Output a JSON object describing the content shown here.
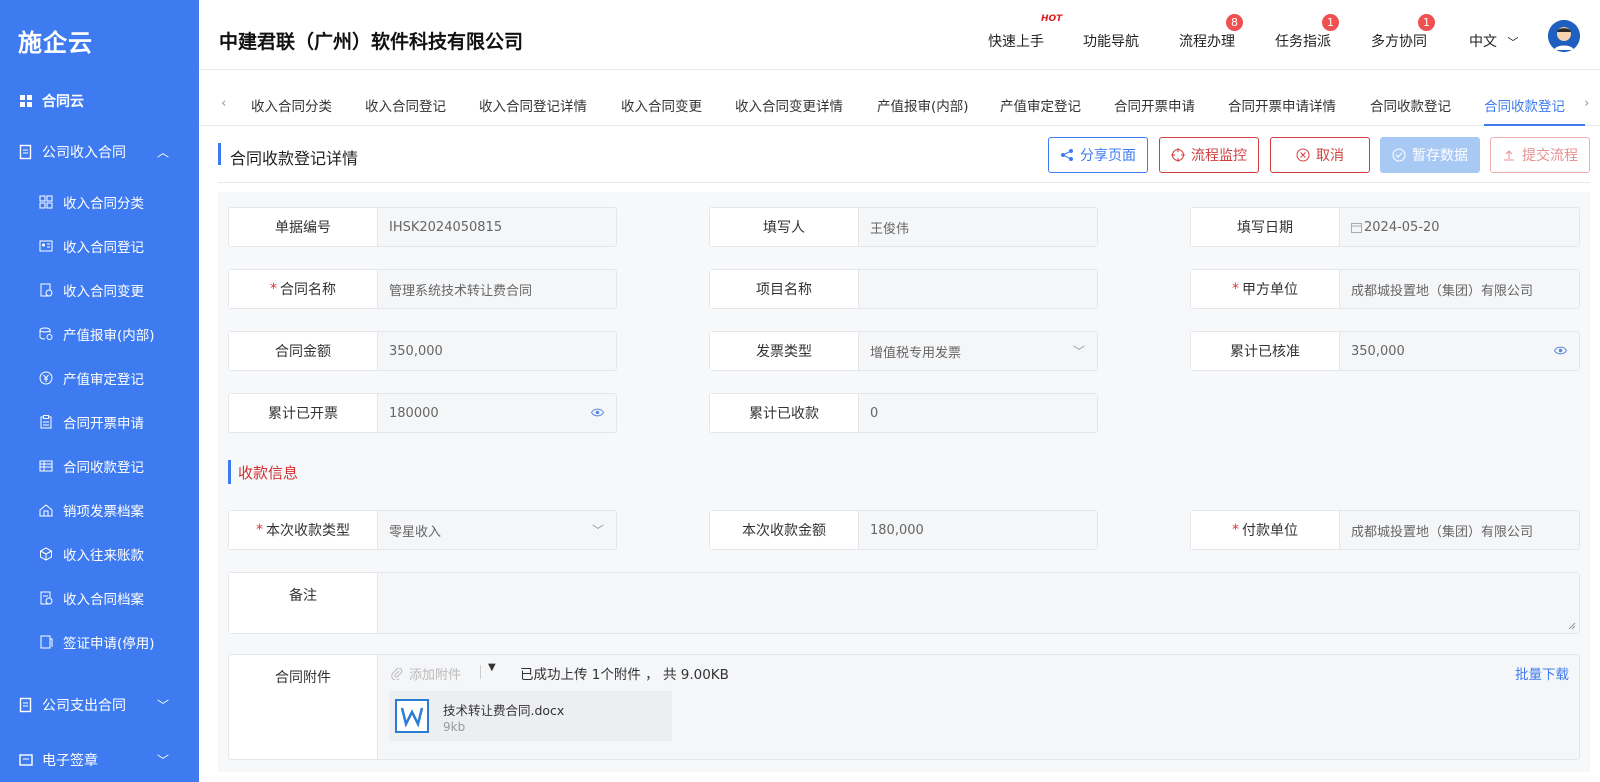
{
  "logo": {
    "text": "施企云"
  },
  "sidebar": {
    "items": [
      {
        "label": "合同云",
        "icon": "grid-icon"
      },
      {
        "label": "公司收入合同",
        "icon": "document-icon"
      },
      {
        "label": "收入合同分类",
        "icon": "category-icon"
      },
      {
        "label": "收入合同登记",
        "icon": "idcard-icon"
      },
      {
        "label": "收入合同变更",
        "icon": "file-edit-icon"
      },
      {
        "label": "产值报审(内部)",
        "icon": "database-icon"
      },
      {
        "label": "产值审定登记",
        "icon": "yuan-icon"
      },
      {
        "label": "合同开票申请",
        "icon": "clipboard-icon"
      },
      {
        "label": "合同收款登记",
        "icon": "table-icon"
      },
      {
        "label": "销项发票档案",
        "icon": "house-icon"
      },
      {
        "label": "收入往来账款",
        "icon": "cube-icon"
      },
      {
        "label": "收入合同档案",
        "icon": "archive-icon"
      },
      {
        "label": "签证申请(停用)",
        "icon": "visa-icon"
      },
      {
        "label": "公司支出合同",
        "icon": "document-icon"
      },
      {
        "label": "电子签章",
        "icon": "seal-icon"
      }
    ]
  },
  "header": {
    "company": "中建君联（广州）软件科技有限公司",
    "nav": [
      {
        "label": "快速上手",
        "badge": ""
      },
      {
        "label": "功能导航",
        "badge": ""
      },
      {
        "label": "流程办理",
        "badge": "8"
      },
      {
        "label": "任务指派",
        "badge": "1"
      },
      {
        "label": "多方协同",
        "badge": "1"
      }
    ],
    "hot": "HOT",
    "lang": "中文"
  },
  "tabs": [
    "收入合同分类",
    "收入合同登记",
    "收入合同登记详情",
    "收入合同变更",
    "收入合同变更详情",
    "产值报审(内部)",
    "产值审定登记",
    "合同开票申请",
    "合同开票申请详情",
    "合同收款登记",
    "合同收款登记"
  ],
  "page": {
    "title": "合同收款登记详情",
    "buttons": {
      "share": "分享页面",
      "monitor": "流程监控",
      "cancel": "取消",
      "save": "暂存数据",
      "submit": "提交流程"
    }
  },
  "form": {
    "doc_no_label": "单据编号",
    "doc_no": "IHSK2024050815",
    "writer_label": "填写人",
    "writer": "王俊伟",
    "date_label": "填写日期",
    "date": "2024-05-20",
    "contract_name_label": "合同名称",
    "contract_name": "管理系统技术转让费合同",
    "project_label": "项目名称",
    "project": "",
    "party_a_label": "甲方单位",
    "party_a": "成都城投置地（集团）有限公司",
    "amount_label": "合同金额",
    "amount": "350,000",
    "invoice_type_label": "发票类型",
    "invoice_type": "增值税专用发票",
    "approved_label": "累计已核准",
    "approved": "350,000",
    "invoiced_label": "累计已开票",
    "invoiced": "180000",
    "received_label": "累计已收款",
    "received": "0"
  },
  "section2": {
    "title": "收款信息"
  },
  "receipt": {
    "type_label": "本次收款类型",
    "type": "零星收入",
    "amount_label": "本次收款金额",
    "amount": "180,000",
    "payer_label": "付款单位",
    "payer": "成都城投置地（集团）有限公司",
    "remark_label": "备注"
  },
  "attachment": {
    "label": "合同附件",
    "add": "添加附件",
    "status": "已成功上传 1个附件 ， 共 9.00KB",
    "batch": "批量下载",
    "file_name": "技术转让费合同.docx",
    "file_size": "9kb"
  }
}
